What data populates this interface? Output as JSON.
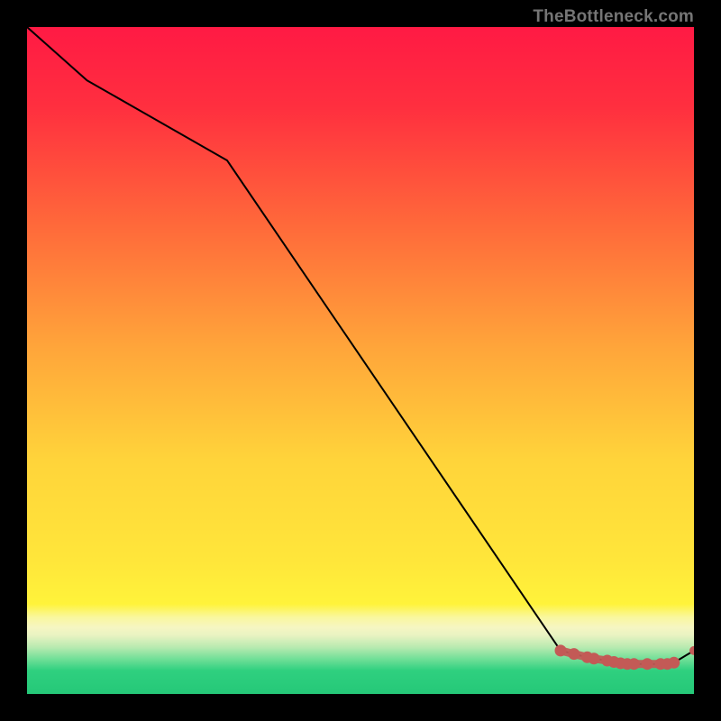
{
  "attribution": "TheBottleneck.com",
  "colors": {
    "background": "#000000",
    "line": "#000000",
    "marker": "#c35a56",
    "gradient_top": "#ff1a44",
    "gradient_mid_orange": "#ff9a3a",
    "gradient_mid_yellow": "#ffe13a",
    "gradient_band_pale": "#f6f6a8",
    "gradient_band_green": "#2fd07f",
    "gradient_bottom": "#2fd07f"
  },
  "chart_data": {
    "type": "line",
    "title": "",
    "xlabel": "",
    "ylabel": "",
    "xlim": [
      0,
      100
    ],
    "ylim": [
      0,
      100
    ],
    "series": [
      {
        "name": "main-line",
        "x": [
          0,
          9,
          30,
          80,
          82,
          84,
          85,
          87,
          88,
          89,
          90,
          91,
          93,
          95,
          96,
          97,
          100
        ],
        "y": [
          100,
          92,
          80,
          6.5,
          6,
          5.5,
          5.3,
          5,
          4.8,
          4.6,
          4.5,
          4.5,
          4.5,
          4.5,
          4.5,
          4.7,
          6.5
        ]
      }
    ],
    "markers": {
      "name": "highlight-points",
      "x": [
        80,
        82,
        84,
        85,
        87,
        88,
        89,
        90,
        91,
        93,
        95,
        96,
        97,
        100
      ],
      "y": [
        6.5,
        6,
        5.5,
        5.3,
        5,
        4.8,
        4.6,
        4.5,
        4.5,
        4.5,
        4.5,
        4.5,
        4.7,
        6.5
      ]
    }
  }
}
